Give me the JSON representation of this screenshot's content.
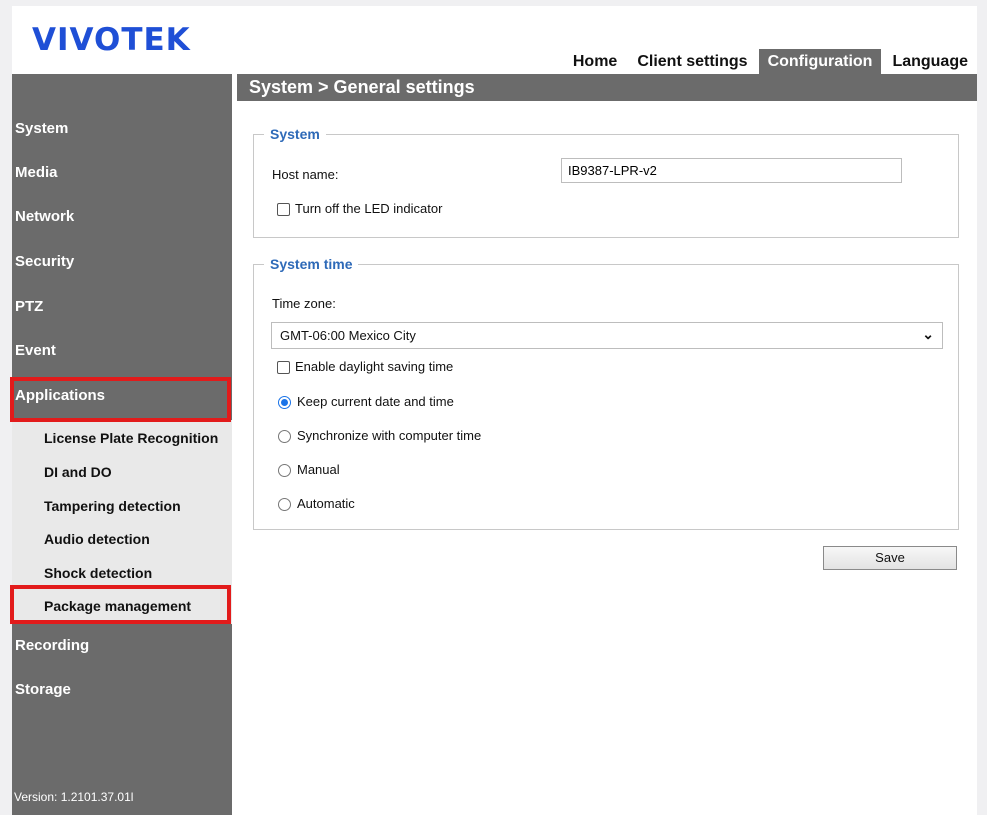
{
  "brand": "VIVOTEK",
  "topnav": {
    "tabs": [
      "Home",
      "Client settings",
      "Configuration",
      "Language"
    ],
    "active": "Configuration"
  },
  "breadcrumb": "System  > General settings",
  "sidebar": {
    "items": [
      "System",
      "Media",
      "Network",
      "Security",
      "PTZ",
      "Event",
      "Applications"
    ],
    "subitems": [
      "License Plate Recognition",
      "DI and DO",
      "Tampering detection",
      "Audio detection",
      "Shock detection",
      "Package management"
    ],
    "items_after": [
      "Recording",
      "Storage"
    ],
    "version": "Version: 1.2101.37.01l"
  },
  "system_section": {
    "title": "System",
    "host_label": "Host name:",
    "host_value": "IB9387-LPR-v2",
    "led_label": "Turn off the LED indicator",
    "led_checked": false
  },
  "time_section": {
    "title": "System time",
    "timezone_label": "Time zone:",
    "timezone_value": "GMT-06:00 Mexico City",
    "dst_label": "Enable daylight saving time",
    "dst_checked": false,
    "options": [
      "Keep current date and time",
      "Synchronize with computer time",
      "Manual",
      "Automatic"
    ],
    "selected_option": "Keep current date and time"
  },
  "save_label": "Save",
  "colors": {
    "sidebar": "#6b6b6b",
    "brand": "#1f4fd6",
    "section_title": "#2e6ab8",
    "highlight": "#e21b1b"
  }
}
